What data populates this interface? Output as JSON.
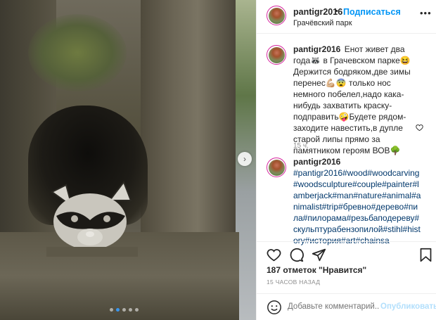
{
  "header": {
    "username": "pantigr2016",
    "separator": "•",
    "follow_label": "Подписаться",
    "location": "Грачёвский парк",
    "more_label": "•••"
  },
  "caption": {
    "username": "pantigr2016",
    "text": "Енот живет два года🦝 в Грачевском парке😆Держится бодряком,две зимы перенес💪🏼😨 только нос немного побелел,надо кака-нибудь захватить краску-подправить🤪Будете рядом-заходите навестить,в дупле старой липы прямо за памятником героям ВОВ🌳",
    "time": "15 ч."
  },
  "hashtag_comment": {
    "username": "pantigr2016",
    "text": "#pantigr2016#wood#woodcarving#woodsculpture#couple#painter#lamberjack#man#nature#animal#animalist#trip#бревно#дерево#пила#пилорама#резьбаподереву#скульптурабензопилой#stihl#history#история#art#chainsa"
  },
  "post": {
    "likes": "187 отметок \"Нравится\"",
    "time": "15 ЧАСОВ НАЗАД"
  },
  "comment_bar": {
    "placeholder": "Добавьте комментарий...",
    "publish_label": "Опубликовать"
  },
  "icons": {
    "like": "heart-icon",
    "comment": "comment-icon",
    "share": "paper-plane-icon",
    "save": "bookmark-icon",
    "emoji": "smiley-icon",
    "next": "chevron-right-icon"
  },
  "colors": {
    "accent": "#0095f6",
    "publish_disabled": "#b2dffc",
    "hashtag": "#00376b",
    "muted": "#8e8e8e"
  },
  "carousel": {
    "slide_count": 5,
    "active_index": 1
  }
}
